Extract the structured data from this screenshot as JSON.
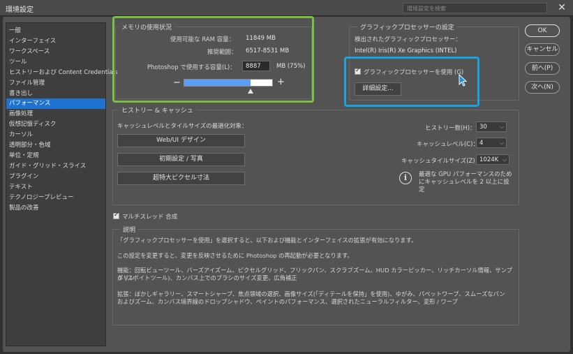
{
  "window": {
    "title": "環境設定",
    "search_placeholder": "環境設定を検索",
    "close_icon": "close-icon"
  },
  "sidebar": {
    "items": [
      {
        "label": "一般",
        "selected": false
      },
      {
        "label": "インターフェイス",
        "selected": false
      },
      {
        "label": "ワークスペース",
        "selected": false
      },
      {
        "label": "ツール",
        "selected": false
      },
      {
        "label": "ヒストリーおよび Content Credentials",
        "selected": false
      },
      {
        "label": "ファイル管理",
        "selected": false
      },
      {
        "label": "書き出し",
        "selected": false
      },
      {
        "label": "パフォーマンス",
        "selected": true
      },
      {
        "label": "画像処理",
        "selected": false
      },
      {
        "label": "仮想記憶ディスク",
        "selected": false
      },
      {
        "label": "カーソル",
        "selected": false
      },
      {
        "label": "透明部分・色域",
        "selected": false
      },
      {
        "label": "単位・定規",
        "selected": false
      },
      {
        "label": "ガイド・グリッド・スライス",
        "selected": false
      },
      {
        "label": "プラグイン",
        "selected": false
      },
      {
        "label": "テキスト",
        "selected": false
      },
      {
        "label": "テクノロジープレビュー",
        "selected": false
      },
      {
        "label": "製品の改善",
        "selected": false
      }
    ]
  },
  "memory": {
    "legend": "メモリの使用状況",
    "available_label": "使用可能な RAM 容量：",
    "available_value": "11849 MB",
    "recommended_label": "推奨範囲：",
    "recommended_value": "6517-8531 MB",
    "use_label": "Photoshop で使用する容量(L)：",
    "use_value": "8887",
    "use_suffix": "MB (75%)",
    "slider_fraction": 0.75,
    "minus": "−",
    "plus": "+"
  },
  "gpu": {
    "legend": "グラフィックプロセッサーの設定",
    "detected_label": "検出されたグラフィックプロセッサー：",
    "detected_value": "Intel(R) Iris(R) Xe Graphics (INTEL)",
    "use_gpu_label": "グラフィックプロセッサーを使用 (G)",
    "use_gpu_checked": true,
    "advanced_button": "詳細設定..."
  },
  "history_cache": {
    "legend": "ヒストリー & キャッシュ",
    "optimize_label": "キャッシュレベルとタイルサイズの最適化対象：",
    "preset_buttons": [
      "Web/UI デザイン",
      "初期設定 / 写真",
      "超特大ピクセル寸法"
    ],
    "history_states_label": "ヒストリー数(H)：",
    "history_states_value": "30",
    "cache_levels_label": "キャッシュレベル(C)：",
    "cache_levels_value": "4",
    "cache_tile_label": "キャッシュタイルサイズ(Z)：",
    "cache_tile_value": "1024K",
    "info_line1": "最適な GPU パフォーマンスのため",
    "info_line2": "にキャッシュレベルを 2 以上に設",
    "info_line3": "定"
  },
  "multithread": {
    "label": "マルチスレッド 合成",
    "checked": true
  },
  "description": {
    "legend": "説明",
    "p1": "「グラフィックプロセッサーを使用」を選択すると、以下および機能とインターフェイスの拡張が有効になります。",
    "p2": "この設定を変更すると、変更を反映させるために Photoshop の再起動が必要となります。",
    "p3a": "機能：回転ビューツール、バーズアイズーム、ピクセルグリッド、フリックパン、スクラブズーム、HUD カラーピッカー、リッチカーソル情報、サンプルリン",
    "p3b": "グ (スポイトツール)、カンバス上でのブラシのサイズ変更、広角補正",
    "p4a": "拡張：ぼかしギャラリー、スマートシャープ、焦点領域の選択、画像サイズ(「ディテールを保持」を使用)、ゆがみ、パペットワープ、スムーズなパン",
    "p4b": "およびズーム、カンバス境界線のドロップシャドウ、ペイントのパフォーマンス、選択されたニューラルフィルター、変形 / ワープ"
  },
  "buttons": {
    "ok": "OK",
    "cancel": "キャンセル",
    "prev": "前へ(P)",
    "next": "次へ(N)"
  },
  "colors": {
    "accent_selected": "#1f72d0",
    "highlight_green": "#7ac143",
    "highlight_blue": "#1aa3e0",
    "slider_fill": "#5b9cf4"
  }
}
